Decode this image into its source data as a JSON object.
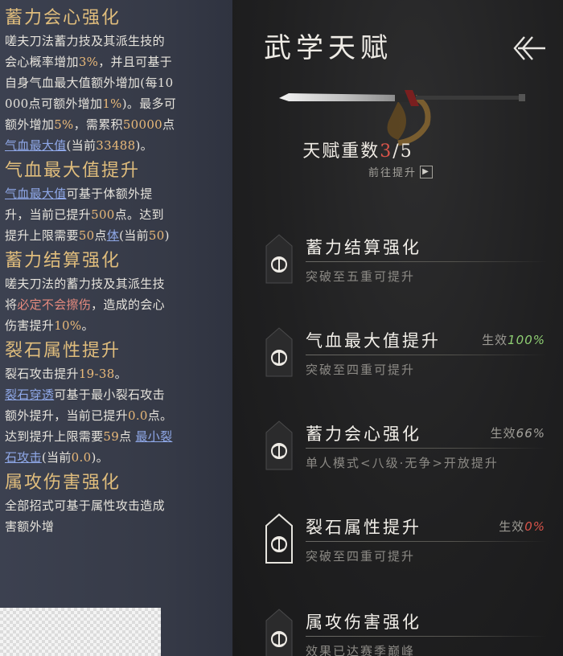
{
  "left_panel": {
    "sections": [
      {
        "title": "蓄力会心强化",
        "lines": [
          [
            {
              "t": "嗟夫刀法蓄力技及其派生技的"
            }
          ],
          [
            {
              "t": "会心概率增加"
            },
            {
              "t": "3%",
              "c": "hl"
            },
            {
              "t": "，并且可基于"
            }
          ],
          [
            {
              "t": "自身气血最大值额外增加(每10"
            }
          ],
          [
            {
              "t": "000点可额外增加"
            },
            {
              "t": "1%",
              "c": "hl"
            },
            {
              "t": ")。最多可"
            }
          ],
          [
            {
              "t": "额外增加"
            },
            {
              "t": "5%",
              "c": "hl"
            },
            {
              "t": "，需累积"
            },
            {
              "t": "50000",
              "c": "hl"
            },
            {
              "t": "点"
            }
          ],
          [
            {
              "t": "气血最大值",
              "c": "link"
            },
            {
              "t": "(当前"
            },
            {
              "t": "33488",
              "c": "hl"
            },
            {
              "t": ")。"
            }
          ]
        ]
      },
      {
        "title": "气血最大值提升",
        "lines": [
          [
            {
              "t": "气血最大值",
              "c": "link"
            },
            {
              "t": "可基于体额外提"
            }
          ],
          [
            {
              "t": "升，当前已提升"
            },
            {
              "t": "500",
              "c": "hl"
            },
            {
              "t": "点。达到"
            }
          ],
          [
            {
              "t": "提升上限需要"
            },
            {
              "t": "50",
              "c": "hl"
            },
            {
              "t": "点"
            },
            {
              "t": "体",
              "c": "link"
            },
            {
              "t": "(当前"
            },
            {
              "t": "50",
              "c": "hl"
            },
            {
              "t": ")"
            }
          ]
        ]
      },
      {
        "title": "蓄力结算强化",
        "lines": [
          [
            {
              "t": "嗟夫刀法的蓄力技及其派生技"
            }
          ],
          [
            {
              "t": "将"
            },
            {
              "t": "必定不会擦伤",
              "c": "red"
            },
            {
              "t": "，造成的会心"
            }
          ],
          [
            {
              "t": "伤害提升"
            },
            {
              "t": "10%",
              "c": "hl"
            },
            {
              "t": "。"
            }
          ]
        ]
      },
      {
        "title": "裂石属性提升",
        "lines": [
          [
            {
              "t": "裂石攻击提升"
            },
            {
              "t": "19-38",
              "c": "hl"
            },
            {
              "t": "。"
            }
          ],
          [
            {
              "t": "裂石穿透",
              "c": "link"
            },
            {
              "t": "可基于最小裂石攻击"
            }
          ],
          [
            {
              "t": "额外提升，当前已提升"
            },
            {
              "t": "0.0",
              "c": "hl"
            },
            {
              "t": "点。"
            }
          ],
          [
            {
              "t": "达到提升上限需要"
            },
            {
              "t": "59",
              "c": "hl"
            },
            {
              "t": "点 "
            },
            {
              "t": "最小裂",
              "c": "link"
            }
          ],
          [
            {
              "t": "石攻击",
              "c": "link"
            },
            {
              "t": "(当前"
            },
            {
              "t": "0.0",
              "c": "hl"
            },
            {
              "t": ")。"
            }
          ]
        ]
      },
      {
        "title": "属攻伤害强化",
        "lines": [
          [
            {
              "t": "全部招式可基于属性攻击造成"
            }
          ],
          [
            {
              "t": "害额外增"
            }
          ]
        ]
      }
    ]
  },
  "right_panel": {
    "title": "武学天赋",
    "back_icon": "back-arrow-icon",
    "talent_count": {
      "label": "天赋重数",
      "current": "3",
      "sep": "/",
      "total": "5"
    },
    "goto_upgrade": "前往提升",
    "talents": [
      {
        "name": "蓄力结算强化",
        "effect_label": "",
        "effect_value": "",
        "effect_color": "",
        "desc": "突破至五重可提升"
      },
      {
        "name": "气血最大值提升",
        "effect_label": "生效",
        "effect_value": "100%",
        "effect_color": "#8fcf73",
        "desc": "突破至四重可提升"
      },
      {
        "name": "蓄力会心强化",
        "effect_label": "生效",
        "effect_value": "66%",
        "effect_color": "#a4a29c",
        "desc": "单人模式<八级·无争>开放提升"
      },
      {
        "name": "裂石属性提升",
        "effect_label": "生效",
        "effect_value": "0%",
        "effect_color": "#d9544a",
        "desc": "突破至四重可提升"
      },
      {
        "name": "属攻伤害强化",
        "effect_label": "",
        "effect_value": "",
        "effect_color": "",
        "desc": "效果已达赛季巅峰"
      }
    ]
  },
  "colors": {
    "gold": "#e0bd7c",
    "red": "#d9544a",
    "green": "#8fcf73",
    "link": "#8fa8e8"
  }
}
